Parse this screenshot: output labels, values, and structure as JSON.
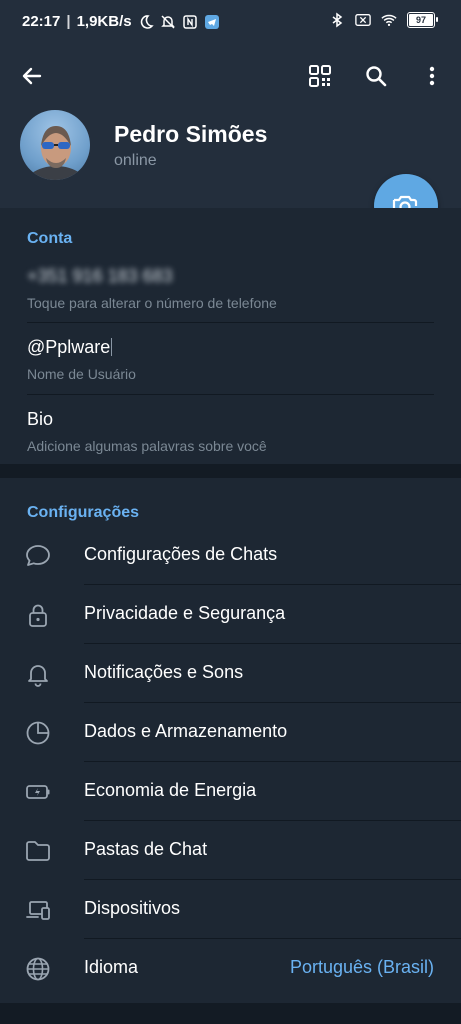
{
  "status_bar": {
    "time": "22:17",
    "speed": "1,9KB/s",
    "battery": "97",
    "battery_level": 0.97
  },
  "header": {
    "back_icon": "arrow-left-icon",
    "qr_icon": "qr-code-icon",
    "search_icon": "search-icon",
    "more_icon": "more-vertical-icon"
  },
  "profile": {
    "name": "Pedro Simões",
    "status": "online",
    "camera_icon": "camera-add-icon"
  },
  "account": {
    "title": "Conta",
    "phone": "+351 916 183 683",
    "phone_hint": "Toque para alterar o número de telefone",
    "username": "@Pplware",
    "username_hint": "Nome de Usuário",
    "bio": "Bio",
    "bio_hint": "Adicione algumas palavras sobre você"
  },
  "settings": {
    "title": "Configurações",
    "items": [
      {
        "label": "Configurações de Chats",
        "icon": "chat-bubble-icon"
      },
      {
        "label": "Privacidade e Segurança",
        "icon": "lock-icon"
      },
      {
        "label": "Notificações e Sons",
        "icon": "bell-icon"
      },
      {
        "label": "Dados e Armazenamento",
        "icon": "pie-chart-icon"
      },
      {
        "label": "Economia de Energia",
        "icon": "battery-saver-icon"
      },
      {
        "label": "Pastas de Chat",
        "icon": "folder-icon"
      },
      {
        "label": "Dispositivos",
        "icon": "devices-icon"
      },
      {
        "label": "Idioma",
        "icon": "globe-icon",
        "value": "Português (Brasil)"
      }
    ]
  },
  "colors": {
    "background": "#1d2733",
    "header": "#232e3c",
    "accent": "#6ab2f2",
    "fab": "#5fa8e3"
  }
}
